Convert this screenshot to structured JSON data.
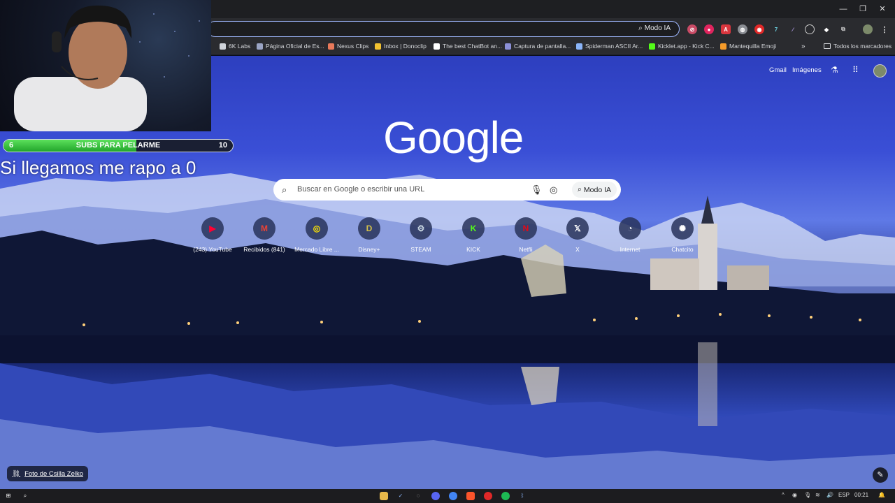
{
  "browser": {
    "omnibox_mode_label": "Modo IA",
    "bookmarks": [
      {
        "label": "6K Labs",
        "color": "#cfd3da"
      },
      {
        "label": "Página Oficial de Es...",
        "color": "#9aa4c4"
      },
      {
        "label": "Nexus Clips",
        "color": "#e8795a"
      },
      {
        "label": "Inbox | Donoclip",
        "color": "#f2c230"
      },
      {
        "label": "The best ChatBot an...",
        "color": "#ffffff"
      },
      {
        "label": "Captura de pantalla...",
        "color": "#8b8fd6"
      },
      {
        "label": "Spiderman ASCII Ar...",
        "color": "#8ab4f8"
      },
      {
        "label": "Kicklet.app - Kick C...",
        "color": "#53fc18"
      },
      {
        "label": "Mantequilla Emoji",
        "color": "#f59b2a"
      }
    ],
    "bookmarks_folder": "Todos los marcadores"
  },
  "stream_overlay": {
    "subs_start": "6",
    "subs_label": "SUBS PARA PELARME",
    "subs_goal": "10",
    "subs_progress": 0.58,
    "message": "Si llegamos me rapo a 0"
  },
  "ntp": {
    "gmail_link": "Gmail",
    "images_link": "Imágenes",
    "logo": "Google",
    "search_placeholder": "Buscar en Google o escribir una URL",
    "mode_button": "Modo IA",
    "shortcuts": [
      {
        "label": "(243) YouTube",
        "glyph": "▶",
        "color": "#ff0033"
      },
      {
        "label": "Recibidos (841)",
        "glyph": "M",
        "color": "#ea4335"
      },
      {
        "label": "Mercado Libre ...",
        "glyph": "◎",
        "color": "#ffe600"
      },
      {
        "label": "Disney+",
        "glyph": "D",
        "color": "#d4c04a"
      },
      {
        "label": "STEAM",
        "glyph": "⚙",
        "color": "#c7d5e0"
      },
      {
        "label": "KICK",
        "glyph": "K",
        "color": "#53fc18"
      },
      {
        "label": "Netfli",
        "glyph": "N",
        "color": "#e50914"
      },
      {
        "label": "X",
        "glyph": "𝕏",
        "color": "#ffffff"
      },
      {
        "label": "Internet",
        "glyph": "◔",
        "color": "#ffffff"
      },
      {
        "label": "Chatcito",
        "glyph": "✺",
        "color": "#ffffff"
      }
    ],
    "photo_credit": "Foto de Csilla Zelko"
  },
  "taskbar": {
    "language": "ESP",
    "time": "00:21"
  }
}
